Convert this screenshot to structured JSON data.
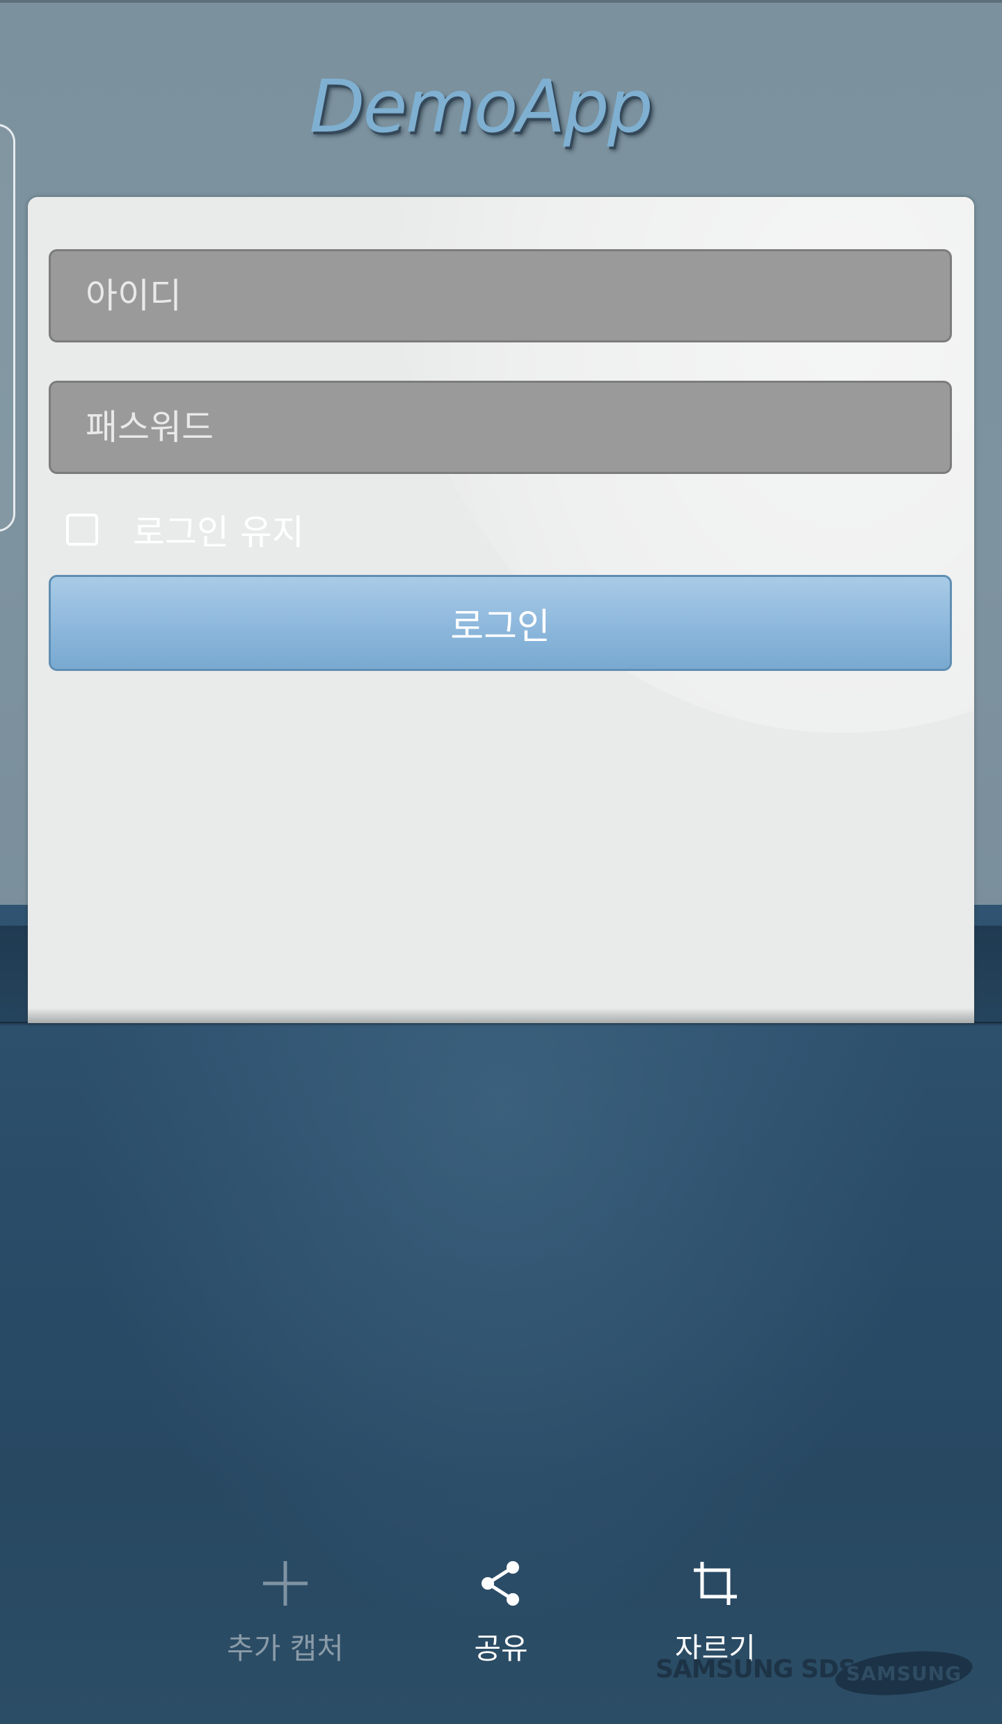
{
  "app": {
    "title": "DemoApp"
  },
  "login": {
    "id_placeholder": "아이디",
    "password_placeholder": "패스워드",
    "keep_login_label": "로그인 유지",
    "keep_login_checked": false,
    "login_button_label": "로그인"
  },
  "capture_toolbar": {
    "add_capture_label": "추가 캡처",
    "add_capture_icon": "plus-icon",
    "share_label": "공유",
    "share_icon": "share-icon",
    "crop_label": "자르기",
    "crop_icon": "crop-icon"
  },
  "watermark": {
    "text": "SAMSUNG SDS",
    "logo_text": "SAMSUNG"
  },
  "colors": {
    "background": "#7c929e",
    "card": "#e9eaea",
    "input": "#9a9a9a",
    "login_button": "#8fb9dd",
    "leather": "#2c4d66",
    "logo": "#7fb0d1"
  }
}
